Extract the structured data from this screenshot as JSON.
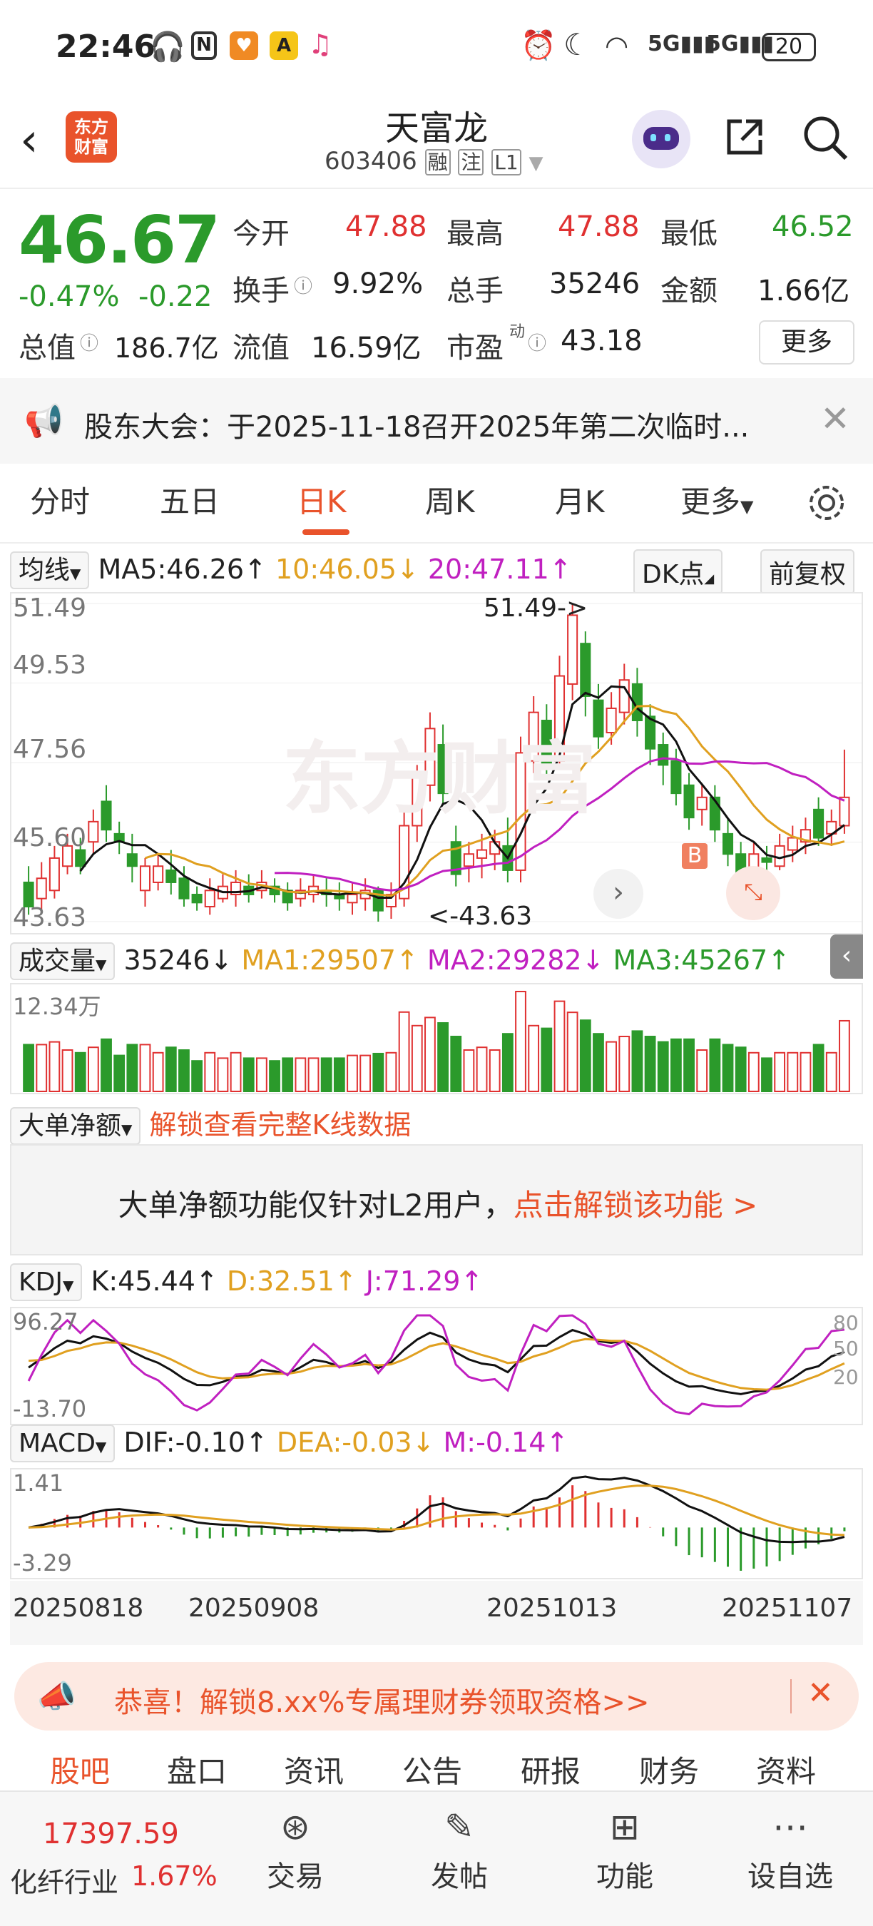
{
  "status": {
    "time": "22:46",
    "battery": "20"
  },
  "header": {
    "title": "天富龙",
    "code": "603406",
    "tags": [
      "融",
      "注",
      "L1"
    ],
    "logo_text": [
      "东方",
      "财富"
    ]
  },
  "quote": {
    "price": "46.67",
    "change_pct": "-0.47%",
    "change_amt": "-0.22",
    "open_label": "今开",
    "open": "47.88",
    "high_label": "最高",
    "high": "47.88",
    "low_label": "最低",
    "low": "46.52",
    "turnover_label": "换手",
    "turnover": "9.92%",
    "volume_label": "总手",
    "volume": "35246",
    "amount_label": "金额",
    "amount": "1.66亿",
    "mktcap_label": "总值",
    "mktcap": "186.7亿",
    "float_label": "流值",
    "float": "16.59亿",
    "pe_label": "市盈",
    "pe_super": "动",
    "pe": "43.18",
    "more": "更多"
  },
  "notice": {
    "text": "股东大会：于2025-11-18召开2025年第二次临时..."
  },
  "tabs": [
    "分时",
    "五日",
    "日K",
    "周K",
    "月K",
    "更多"
  ],
  "active_tab": "日K",
  "kline": {
    "ma_selector": "均线",
    "ma5": "MA5:46.26↑",
    "ma10": "10:46.05↓",
    "ma20": "20:47.11↑",
    "dk": "DK点",
    "adjust": "前复权",
    "y_labels": [
      "51.49",
      "49.53",
      "47.56",
      "45.60",
      "43.63"
    ],
    "high_marker": "51.49->",
    "low_marker": "<-43.63",
    "b_marker": "B",
    "watermark": "东方财富"
  },
  "volume": {
    "selector": "成交量",
    "value": "35246↓",
    "ma1": "MA1:29507↑",
    "ma2": "MA2:29282↓",
    "ma3": "MA3:45267↑",
    "ymax": "12.34万"
  },
  "bigorder": {
    "selector": "大单净额",
    "unlock": "解锁查看完整K线数据",
    "msg": "大单净额功能仅针对L2用户，",
    "link": "点击解锁该功能 >"
  },
  "kdj": {
    "selector": "KDJ",
    "k": "K:45.44↑",
    "d": "D:32.51↑",
    "j": "J:71.29↑",
    "ymax": "96.27",
    "ymin": "-13.70",
    "levels": [
      "80",
      "50",
      "20"
    ]
  },
  "macd": {
    "selector": "MACD",
    "dif": "DIF:-0.10↑",
    "dea": "DEA:-0.03↓",
    "m": "M:-0.14↑",
    "ymax": "1.41",
    "ymin": "-3.29"
  },
  "dates": [
    "20250818",
    "20250908",
    "20251013",
    "20251107"
  ],
  "promo": {
    "text": "恭喜！解锁8.xx%专属理财券领取资格>>"
  },
  "subtabs": [
    "股吧",
    "盘口",
    "资讯",
    "公告",
    "研报",
    "财务",
    "资料"
  ],
  "bottom": {
    "index_value": "17397.59",
    "industry": "化纤行业",
    "industry_pct": "1.67%",
    "items": [
      "交易",
      "发帖",
      "功能",
      "设自选"
    ]
  },
  "colors": {
    "up": "#e03131",
    "down": "#2b9a2b",
    "accent": "#e9532b",
    "ma_orange": "#e0a020",
    "ma_magenta": "#c020c0"
  },
  "chart_data": {
    "type": "candlestick",
    "candles": [
      {
        "o": 44.6,
        "c": 44.0,
        "h": 45.0,
        "l": 43.8
      },
      {
        "o": 44.2,
        "c": 44.7,
        "h": 45.1,
        "l": 43.9
      },
      {
        "o": 44.4,
        "c": 45.2,
        "h": 45.5,
        "l": 44.2
      },
      {
        "o": 45.0,
        "c": 45.5,
        "h": 45.8,
        "l": 44.8
      },
      {
        "o": 45.4,
        "c": 45.0,
        "h": 45.7,
        "l": 44.8
      },
      {
        "o": 45.6,
        "c": 46.1,
        "h": 46.4,
        "l": 45.3
      },
      {
        "o": 46.6,
        "c": 45.9,
        "h": 47.0,
        "l": 45.6
      },
      {
        "o": 45.8,
        "c": 45.6,
        "h": 46.1,
        "l": 45.3
      },
      {
        "o": 45.3,
        "c": 45.0,
        "h": 45.8,
        "l": 44.6
      },
      {
        "o": 44.4,
        "c": 45.0,
        "h": 45.2,
        "l": 44.0
      },
      {
        "o": 44.6,
        "c": 45.0,
        "h": 45.3,
        "l": 44.4
      },
      {
        "o": 44.9,
        "c": 44.6,
        "h": 45.4,
        "l": 44.3
      },
      {
        "o": 44.7,
        "c": 44.2,
        "h": 45.0,
        "l": 44.0
      },
      {
        "o": 44.3,
        "c": 44.1,
        "h": 44.5,
        "l": 43.9
      },
      {
        "o": 44.0,
        "c": 44.4,
        "h": 44.7,
        "l": 43.8
      },
      {
        "o": 44.2,
        "c": 44.5,
        "h": 44.8,
        "l": 44.1
      },
      {
        "o": 44.3,
        "c": 44.6,
        "h": 44.9,
        "l": 44.0
      },
      {
        "o": 44.5,
        "c": 44.3,
        "h": 44.8,
        "l": 44.1
      },
      {
        "o": 44.4,
        "c": 44.6,
        "h": 44.9,
        "l": 44.2
      },
      {
        "o": 44.5,
        "c": 44.3,
        "h": 44.7,
        "l": 44.1
      },
      {
        "o": 44.4,
        "c": 44.1,
        "h": 44.6,
        "l": 43.9
      },
      {
        "o": 44.2,
        "c": 44.4,
        "h": 44.7,
        "l": 44.0
      },
      {
        "o": 44.3,
        "c": 44.5,
        "h": 44.8,
        "l": 44.1
      },
      {
        "o": 44.4,
        "c": 44.3,
        "h": 44.7,
        "l": 44.0
      },
      {
        "o": 44.3,
        "c": 44.2,
        "h": 44.6,
        "l": 43.9
      },
      {
        "o": 44.1,
        "c": 44.3,
        "h": 44.6,
        "l": 43.8
      },
      {
        "o": 44.2,
        "c": 44.4,
        "h": 44.7,
        "l": 43.9
      },
      {
        "o": 44.4,
        "c": 43.9,
        "h": 44.5,
        "l": 43.63
      },
      {
        "o": 44.0,
        "c": 44.3,
        "h": 44.6,
        "l": 43.7
      },
      {
        "o": 44.2,
        "c": 46.0,
        "h": 46.4,
        "l": 44.0
      },
      {
        "o": 46.0,
        "c": 47.2,
        "h": 47.5,
        "l": 45.6
      },
      {
        "o": 47.0,
        "c": 48.4,
        "h": 48.8,
        "l": 46.6
      },
      {
        "o": 48.0,
        "c": 46.8,
        "h": 48.5,
        "l": 46.5
      },
      {
        "o": 45.6,
        "c": 44.8,
        "h": 46.0,
        "l": 44.5
      },
      {
        "o": 45.0,
        "c": 45.3,
        "h": 45.6,
        "l": 44.6
      },
      {
        "o": 45.2,
        "c": 45.4,
        "h": 45.8,
        "l": 44.7
      },
      {
        "o": 45.3,
        "c": 45.6,
        "h": 45.9,
        "l": 44.9
      },
      {
        "o": 45.5,
        "c": 44.9,
        "h": 46.2,
        "l": 44.6
      },
      {
        "o": 44.9,
        "c": 47.8,
        "h": 48.2,
        "l": 44.6
      },
      {
        "o": 47.6,
        "c": 48.8,
        "h": 49.2,
        "l": 47.3
      },
      {
        "o": 48.6,
        "c": 47.5,
        "h": 49.0,
        "l": 47.2
      },
      {
        "o": 47.6,
        "c": 49.7,
        "h": 50.2,
        "l": 47.4
      },
      {
        "o": 49.5,
        "c": 51.2,
        "h": 51.49,
        "l": 49.1
      },
      {
        "o": 50.5,
        "c": 49.2,
        "h": 50.8,
        "l": 48.7
      },
      {
        "o": 49.1,
        "c": 48.2,
        "h": 49.5,
        "l": 47.9
      },
      {
        "o": 48.3,
        "c": 48.9,
        "h": 49.3,
        "l": 48.0
      },
      {
        "o": 48.8,
        "c": 49.6,
        "h": 50.0,
        "l": 48.5
      },
      {
        "o": 49.5,
        "c": 48.6,
        "h": 49.9,
        "l": 48.2
      },
      {
        "o": 48.7,
        "c": 47.9,
        "h": 49.0,
        "l": 47.5
      },
      {
        "o": 48.0,
        "c": 47.5,
        "h": 48.3,
        "l": 47.0
      },
      {
        "o": 47.6,
        "c": 46.8,
        "h": 47.9,
        "l": 46.5
      },
      {
        "o": 47.0,
        "c": 46.2,
        "h": 47.3,
        "l": 45.9
      },
      {
        "o": 46.4,
        "c": 46.7,
        "h": 47.0,
        "l": 46.0
      },
      {
        "o": 46.7,
        "c": 45.9,
        "h": 47.0,
        "l": 45.6
      },
      {
        "o": 45.8,
        "c": 45.3,
        "h": 46.2,
        "l": 45.0
      },
      {
        "o": 45.3,
        "c": 44.8,
        "h": 45.6,
        "l": 44.5
      },
      {
        "o": 44.9,
        "c": 45.3,
        "h": 45.6,
        "l": 44.7
      },
      {
        "o": 45.2,
        "c": 45.1,
        "h": 45.5,
        "l": 44.8
      },
      {
        "o": 45.0,
        "c": 45.5,
        "h": 45.8,
        "l": 44.9
      },
      {
        "o": 45.4,
        "c": 45.7,
        "h": 46.0,
        "l": 45.1
      },
      {
        "o": 45.6,
        "c": 45.9,
        "h": 46.2,
        "l": 45.3
      },
      {
        "o": 46.4,
        "c": 45.7,
        "h": 46.7,
        "l": 45.5
      },
      {
        "o": 45.8,
        "c": 46.1,
        "h": 46.4,
        "l": 45.5
      },
      {
        "o": 46.0,
        "c": 46.7,
        "h": 47.88,
        "l": 45.8
      }
    ],
    "ylim": [
      43.63,
      51.49
    ]
  }
}
